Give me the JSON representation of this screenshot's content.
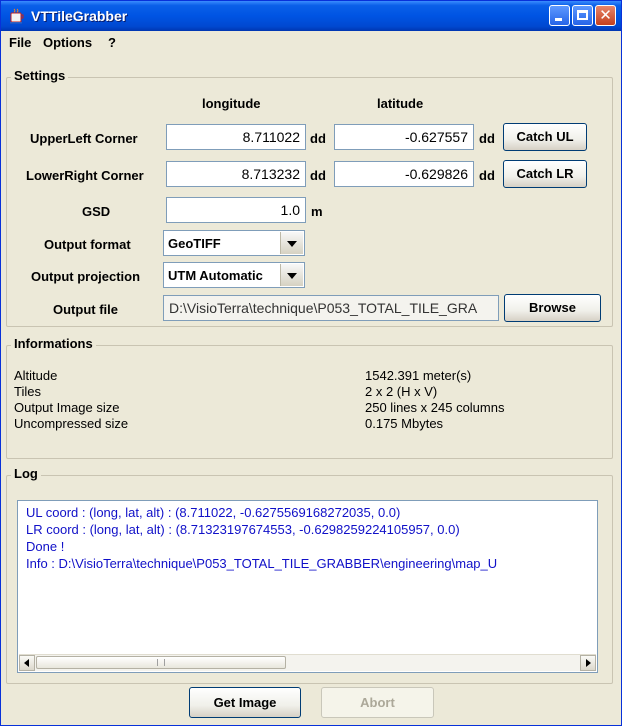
{
  "window": {
    "title": "VTTileGrabber",
    "app_icon": "java-cup-icon",
    "controls": {
      "minimize": "minimize-icon",
      "maximize": "maximize-icon",
      "close": "close-icon",
      "close_glyph": "✕"
    },
    "titlebar_color": "#0054e3"
  },
  "menu": {
    "items": [
      "File",
      "Options",
      "?"
    ]
  },
  "settings": {
    "title": "Settings",
    "col_headers": {
      "longitude": "longitude",
      "latitude": "latitude"
    },
    "upper_left": {
      "label": "UpperLeft Corner",
      "lon": "8.711022",
      "lat": "-0.627557",
      "unit": "dd",
      "button": "Catch UL"
    },
    "lower_right": {
      "label": "LowerRight Corner",
      "lon": "8.713232",
      "lat": "-0.629826",
      "unit": "dd",
      "button": "Catch LR"
    },
    "gsd": {
      "label": "GSD",
      "value": "1.0",
      "unit": "m"
    },
    "output_format": {
      "label": "Output format",
      "value": "GeoTIFF"
    },
    "output_projection": {
      "label": "Output projection",
      "value": "UTM Automatic"
    },
    "output_file": {
      "label": "Output file",
      "value": "D:\\VisioTerra\\technique\\P053_TOTAL_TILE_GRA",
      "button": "Browse"
    }
  },
  "informations": {
    "title": "Informations",
    "rows": [
      {
        "label": "Altitude",
        "value": "1542.391 meter(s)"
      },
      {
        "label": "Tiles",
        "value": "2 x 2 (H x V)"
      },
      {
        "label": "Output Image size",
        "value": "250 lines x 245 columns"
      },
      {
        "label": "Uncompressed size",
        "value": "0.175 Mbytes"
      }
    ]
  },
  "log": {
    "title": "Log",
    "text_color": "#1010c8",
    "lines": [
      "UL coord : (long,  lat, alt) : (8.711022, -0.6275569168272035, 0.0)",
      "LR coord : (long,  lat, alt) : (8.71323197674553, -0.6298259224105957, 0.0)",
      "Done !",
      "Info : D:\\VisioTerra\\technique\\P053_TOTAL_TILE_GRABBER\\engineering\\map_U"
    ]
  },
  "actions": {
    "get_image": "Get Image",
    "abort": "Abort"
  }
}
